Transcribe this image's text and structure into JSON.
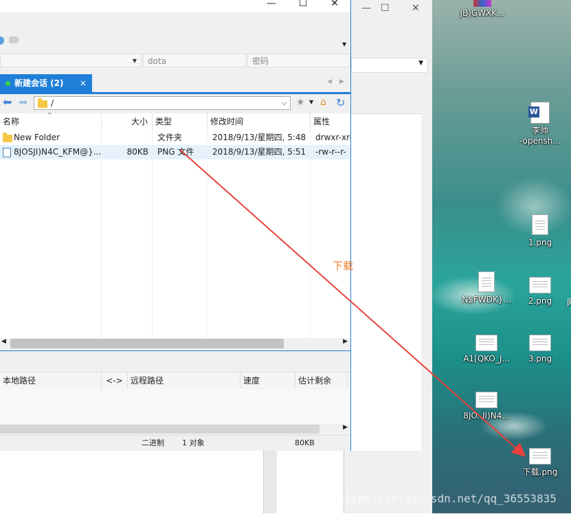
{
  "desktop": {
    "icons": [
      {
        "label": "JB)GWXK...",
        "type": "image"
      },
      {
        "label": "李帅\n-opensh...",
        "type": "word"
      },
      {
        "label": "1.png",
        "type": "png"
      },
      {
        "label": "N$FWDK}...",
        "type": "doc"
      },
      {
        "label": "2.png",
        "type": "png"
      },
      {
        "label": "A1[QKO_J...",
        "type": "png"
      },
      {
        "label": "3.png",
        "type": "png"
      },
      {
        "label": "8JO..JI)N4...",
        "type": "png"
      },
      {
        "label": "下载.png",
        "type": "png"
      }
    ],
    "edge_char": "网"
  },
  "main_window": {
    "controls": {
      "minimize": "—",
      "maximize": "☐",
      "close": "✕"
    },
    "fields": {
      "user": "dota",
      "password": "密码"
    },
    "tab": {
      "label": "新建会话 (2)",
      "close": "×"
    },
    "path": "/",
    "columns": [
      "名称",
      "大小",
      "类型",
      "修改时间",
      "属性"
    ],
    "files": [
      {
        "name": "New Folder",
        "size": "",
        "type": "文件夹",
        "modified": "2018/9/13/星期四, 5:48",
        "attr": "drwxr-xr-"
      },
      {
        "name": "8JOSJI)N4C_KFM@}...",
        "size": "80KB",
        "type": "PNG 文件",
        "modified": "2018/9/13/星期四, 5:51",
        "attr": "-rw-r--r-"
      }
    ],
    "queue_columns": [
      "本地路径",
      "<->",
      "远程路径",
      "速度",
      "估计剩余"
    ],
    "status": {
      "mode": "二进制",
      "objects": "1 对象",
      "size": "80KB"
    }
  },
  "background_window": {
    "controls": {
      "minimize": "—",
      "maximize": "☐",
      "close": "✕"
    }
  },
  "annotation": {
    "text": "下载",
    "arrow_color": "#e8403a"
  },
  "watermark": "https://blog.csdn.net/qq_36553835"
}
